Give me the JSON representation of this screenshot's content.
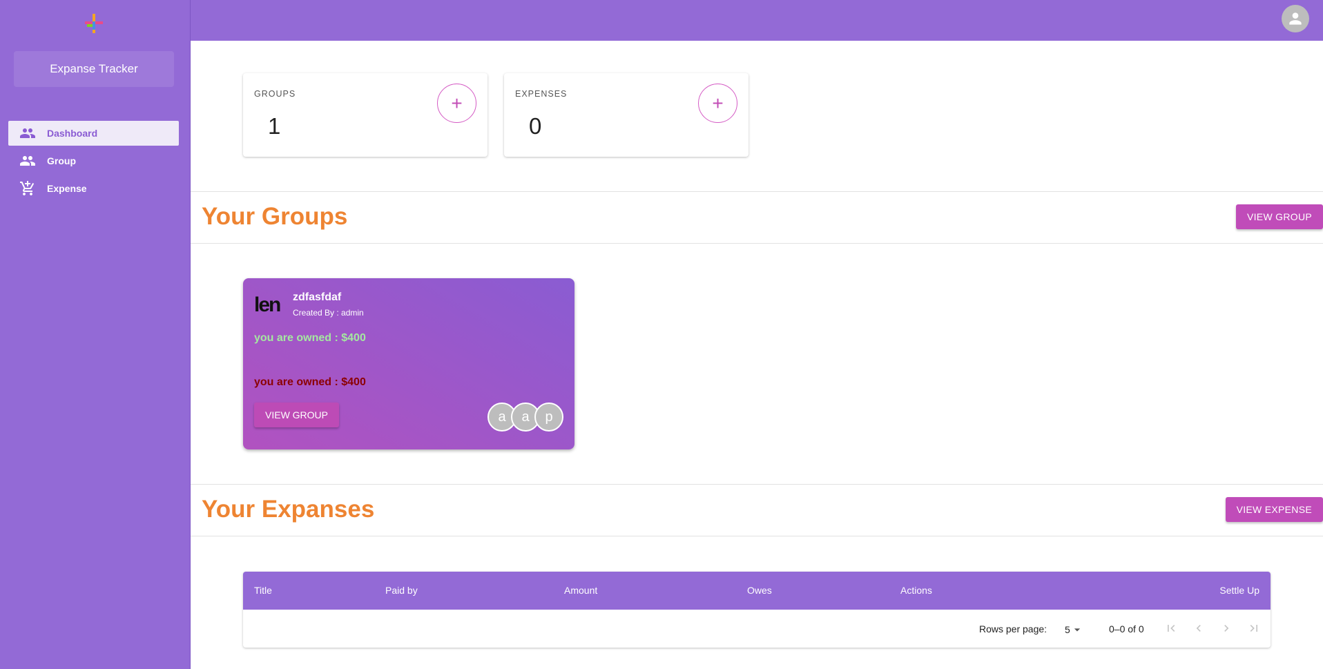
{
  "sidebar": {
    "brand": "Expanse Tracker",
    "items": [
      {
        "label": "Dashboard",
        "icon": "people-icon"
      },
      {
        "label": "Group",
        "icon": "people-icon"
      },
      {
        "label": "Expense",
        "icon": "cart-icon"
      }
    ]
  },
  "stats": [
    {
      "label": "GROUPS",
      "value": "1"
    },
    {
      "label": "EXPENSES",
      "value": "0"
    }
  ],
  "groups_section": {
    "title": "Your Groups",
    "button": "VIEW GROUP"
  },
  "group_card": {
    "logo_text": "len",
    "name": "zdfasfdaf",
    "created_by": "Created By : admin",
    "owed_line_1": "you are owned : $400",
    "owed_line_2": "you are owned : $400",
    "button": "VIEW GROUP",
    "members": [
      "a",
      "a",
      "p"
    ]
  },
  "expenses_section": {
    "title": "Your Expanses",
    "button": "VIEW EXPENSE"
  },
  "table": {
    "columns": [
      "Title",
      "Paid by",
      "Amount",
      "Owes",
      "Actions",
      "Settle Up"
    ],
    "rows_per_page_label": "Rows per page:",
    "rows_per_page": "5",
    "range": "0–0 of 0"
  },
  "colors": {
    "sidebar": "#936ad6",
    "accent": "#c04cb9",
    "title": "#ee8432"
  }
}
